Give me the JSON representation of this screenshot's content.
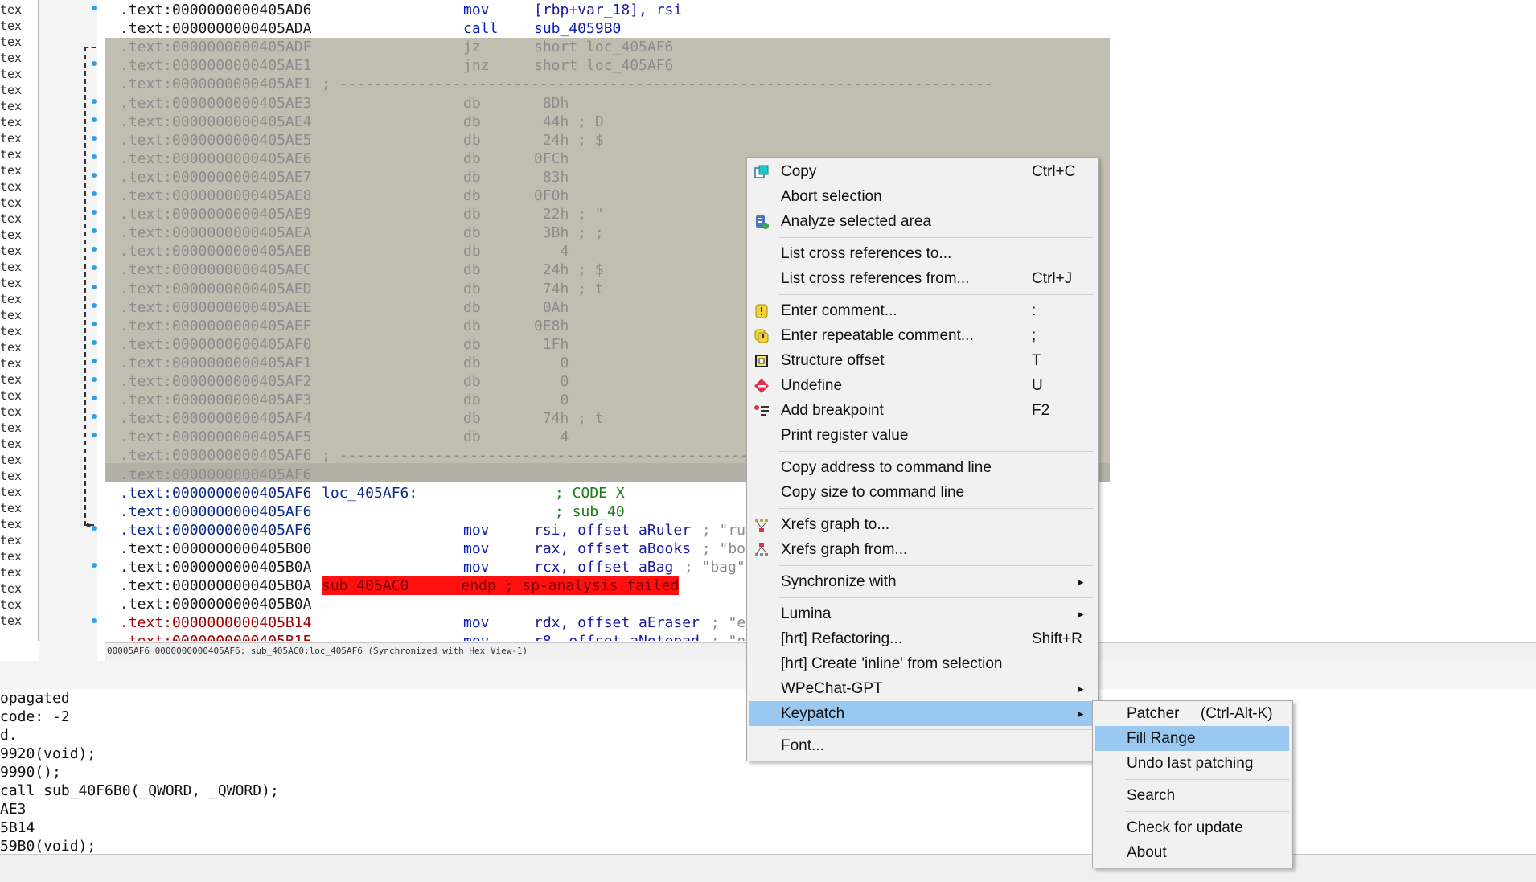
{
  "left_pane": {
    "item_label": "tex"
  },
  "disasm": {
    "rows": [
      {
        "addr": ".text:0000000000405AD6",
        "mn": "mov",
        "op": "[rbp+var_18], rsi",
        "op_color": "c-name"
      },
      {
        "addr": ".text:0000000000405ADA",
        "mn": "call",
        "op": "sub_4059B0",
        "op_color": "c-blue"
      },
      {
        "addr": ".text:0000000000405ADF",
        "mn": "jz",
        "op": "short loc_405AF6",
        "op_color": "c-gray"
      },
      {
        "addr": ".text:0000000000405AE1",
        "mn": "jnz",
        "op": "short loc_405AF6",
        "op_color": "c-gray"
      },
      {
        "addr": ".text:0000000000405AE1",
        "sep": "; ---------------------------------------------------------------------------"
      },
      {
        "addr": ".text:0000000000405AE3",
        "mn": "db",
        "op": " 8Dh"
      },
      {
        "addr": ".text:0000000000405AE4",
        "mn": "db",
        "op": " 44h ; D"
      },
      {
        "addr": ".text:0000000000405AE5",
        "mn": "db",
        "op": " 24h ; $"
      },
      {
        "addr": ".text:0000000000405AE6",
        "mn": "db",
        "op": "0FCh"
      },
      {
        "addr": ".text:0000000000405AE7",
        "mn": "db",
        "op": " 83h"
      },
      {
        "addr": ".text:0000000000405AE8",
        "mn": "db",
        "op": "0F0h"
      },
      {
        "addr": ".text:0000000000405AE9",
        "mn": "db",
        "op": " 22h ; \""
      },
      {
        "addr": ".text:0000000000405AEA",
        "mn": "db",
        "op": " 3Bh ; ;"
      },
      {
        "addr": ".text:0000000000405AEB",
        "mn": "db",
        "op": "   4"
      },
      {
        "addr": ".text:0000000000405AEC",
        "mn": "db",
        "op": " 24h ; $"
      },
      {
        "addr": ".text:0000000000405AED",
        "mn": "db",
        "op": " 74h ; t"
      },
      {
        "addr": ".text:0000000000405AEE",
        "mn": "db",
        "op": " 0Ah"
      },
      {
        "addr": ".text:0000000000405AEF",
        "mn": "db",
        "op": "0E8h"
      },
      {
        "addr": ".text:0000000000405AF0",
        "mn": "db",
        "op": " 1Fh"
      },
      {
        "addr": ".text:0000000000405AF1",
        "mn": "db",
        "op": "   0"
      },
      {
        "addr": ".text:0000000000405AF2",
        "mn": "db",
        "op": "   0"
      },
      {
        "addr": ".text:0000000000405AF3",
        "mn": "db",
        "op": "   0"
      },
      {
        "addr": ".text:0000000000405AF4",
        "mn": "db",
        "op": " 74h ; t"
      },
      {
        "addr": ".text:0000000000405AF5",
        "mn": "db",
        "op": "   4"
      },
      {
        "addr": ".text:0000000000405AF6",
        "sep": "; ------------------------------------------------"
      },
      {
        "addr": ".text:0000000000405AF6"
      },
      {
        "addr": ".text:0000000000405AF6",
        "addr_color": "c-dark",
        "label": "loc_405AF6:",
        "comment": "; CODE X",
        "comment_color": "c-green"
      },
      {
        "addr": ".text:0000000000405AF6",
        "addr_color": "c-dark",
        "comment": "; sub_40",
        "comment_color": "c-green"
      },
      {
        "addr": ".text:0000000000405AF6",
        "addr_color": "c-dark",
        "mn": "mov",
        "op": "rsi, offset aRuler",
        "op_color": "c-name",
        "tail": " ; \"ru"
      },
      {
        "addr": ".text:0000000000405B00",
        "mn": "mov",
        "op": "rax, offset aBooks",
        "op_color": "c-name",
        "tail": " ; \"bo"
      },
      {
        "addr": ".text:0000000000405B0A",
        "mn": "mov",
        "op": "rcx, offset aBag",
        "op_color": "c-name",
        "tail": " ; \"bag\""
      },
      {
        "addr": ".text:0000000000405B0A",
        "error": "sub_405AC0      endp ; sp-analysis failed"
      },
      {
        "addr": ".text:0000000000405B0A"
      },
      {
        "addr": ".text:0000000000405B14",
        "addr_color": "c-red",
        "mn": "mov",
        "op": "rdx, offset aEraser",
        "op_color": "c-name",
        "tail": " ; \"e"
      },
      {
        "addr": ".text:0000000000405B1E",
        "addr_color": "c-red",
        "mn": "mov",
        "op": "r8, offset aNotepad",
        "op_color": "c-name",
        "tail": " ; \"n"
      }
    ]
  },
  "status_bar": {
    "text": "00005AF6 0000000000405AF6: sub_405AC0:loc_405AF6 (Synchronized with Hex View-1)"
  },
  "output": {
    "lines": [
      "opagated",
      "code: -2",
      "d.",
      "9920(void);",
      "9990();",
      "call sub_40F6B0(_QWORD, _QWORD);",
      "AE3",
      "5B14",
      "59B0(void);"
    ]
  },
  "context_menu": {
    "copy": {
      "label": "Copy",
      "shortcut": "Ctrl+C",
      "icon": "copy-icon"
    },
    "abort_selection": {
      "label": "Abort selection"
    },
    "analyze_selected": {
      "label": "Analyze selected area",
      "icon": "analyze-icon"
    },
    "list_xrefs_to": {
      "label": "List cross references to..."
    },
    "list_xrefs_from": {
      "label": "List cross references from...",
      "shortcut": "Ctrl+J"
    },
    "enter_comment": {
      "label": "Enter comment...",
      "shortcut": ":",
      "icon": "comment-icon"
    },
    "enter_repeatable": {
      "label": "Enter repeatable comment...",
      "shortcut": ";",
      "icon": "repeatable-comment-icon"
    },
    "structure_offset": {
      "label": "Structure offset",
      "shortcut": "T",
      "icon": "structure-icon"
    },
    "undefine": {
      "label": "Undefine",
      "shortcut": "U",
      "icon": "undefine-icon"
    },
    "add_breakpoint": {
      "label": "Add breakpoint",
      "shortcut": "F2",
      "icon": "breakpoint-icon"
    },
    "print_register": {
      "label": "Print register value"
    },
    "copy_address": {
      "label": "Copy address to command line"
    },
    "copy_size": {
      "label": "Copy size to command line"
    },
    "xrefs_graph_to": {
      "label": "Xrefs graph to...",
      "icon": "graph-to-icon"
    },
    "xrefs_graph_from": {
      "label": "Xrefs graph from...",
      "icon": "graph-from-icon"
    },
    "synchronize": {
      "label": "Synchronize with"
    },
    "lumina": {
      "label": "Lumina"
    },
    "refactoring": {
      "label": "[hrt] Refactoring...",
      "shortcut": "Shift+R"
    },
    "create_inline": {
      "label": "[hrt] Create 'inline' from selection"
    },
    "wpechat": {
      "label": "WPeChat-GPT"
    },
    "keypatch": {
      "label": "Keypatch"
    },
    "font": {
      "label": "Font..."
    }
  },
  "submenu": {
    "patcher": {
      "label": "Patcher     (Ctrl-Alt-K)"
    },
    "fill_range": {
      "label": "Fill Range"
    },
    "undo_patching": {
      "label": "Undo last patching"
    },
    "search": {
      "label": "Search"
    },
    "check_update": {
      "label": "Check for update"
    },
    "about": {
      "label": "About"
    }
  },
  "colors": {
    "selection": "#c0bdb1",
    "highlight": "#99c9f0",
    "error": "#ff1010"
  }
}
